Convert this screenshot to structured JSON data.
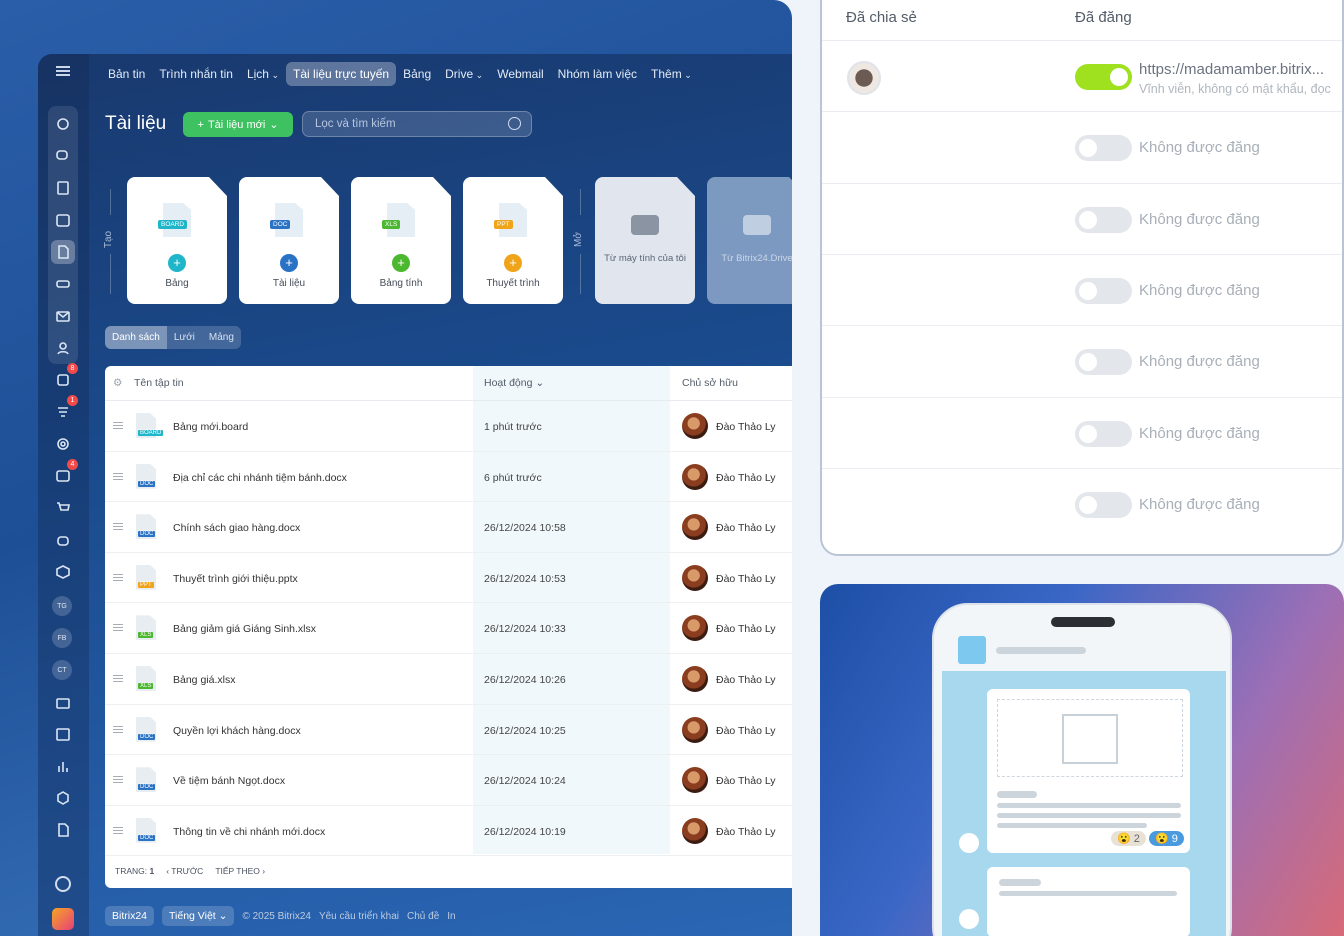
{
  "topnav": [
    "Bản tin",
    "Trình nhắn tin",
    "Lịch",
    "Tài liệu trực tuyến",
    "Bảng",
    "Drive",
    "Webmail",
    "Nhóm làm việc",
    "Thêm"
  ],
  "topnav_dropdowns": [
    "Lịch",
    "Drive",
    "Thêm"
  ],
  "active_tab": "Tài liệu trực tuyến",
  "page_title": "Tài liệu",
  "new_doc_button": "Tài liệu mới",
  "search_placeholder": "Lọc và tìm kiếm",
  "create_label": "Tạo",
  "open_label": "Mở",
  "create_cards": [
    {
      "tag": "BOARD",
      "label": "Bảng",
      "color": "#1fb6c9"
    },
    {
      "tag": "DOC",
      "label": "Tài liệu",
      "color": "#2a72c4"
    },
    {
      "tag": "XLS",
      "label": "Bảng tính",
      "color": "#4cb82f"
    },
    {
      "tag": "PPT",
      "label": "Thuyết trình",
      "color": "#f0a419"
    }
  ],
  "open_cards": [
    "Từ máy tính của tôi",
    "Từ Bitrix24.Drive"
  ],
  "view_switch": [
    "Danh sách",
    "Lưới",
    "Mảng"
  ],
  "grid": {
    "headers": [
      "Tên tập tin",
      "Hoạt động",
      "Chủ sở hữu"
    ],
    "rows": [
      {
        "tag": "BOARD",
        "name": "Bảng mới.board",
        "activity": "1 phút trước",
        "owner": "Đào Thảo Ly"
      },
      {
        "tag": "DOC",
        "name": "Địa chỉ các chi nhánh tiệm bánh.docx",
        "activity": "6 phút trước",
        "owner": "Đào Thảo Ly"
      },
      {
        "tag": "DOC",
        "name": "Chính sách giao hàng.docx",
        "activity": "26/12/2024 10:58",
        "owner": "Đào Thảo Ly"
      },
      {
        "tag": "PPT",
        "name": "Thuyết trình giới thiệu.pptx",
        "activity": "26/12/2024 10:53",
        "owner": "Đào Thảo Ly"
      },
      {
        "tag": "XLS",
        "name": "Bảng giảm giá Giáng Sinh.xlsx",
        "activity": "26/12/2024 10:33",
        "owner": "Đào Thảo Ly"
      },
      {
        "tag": "XLS",
        "name": "Bảng giá.xlsx",
        "activity": "26/12/2024 10:26",
        "owner": "Đào Thảo Ly"
      },
      {
        "tag": "DOC",
        "name": "Quyền lợi khách hàng.docx",
        "activity": "26/12/2024 10:25",
        "owner": "Đào Thảo Ly"
      },
      {
        "tag": "DOC",
        "name": "Về tiệm bánh Ngọt.docx",
        "activity": "26/12/2024 10:24",
        "owner": "Đào Thảo Ly"
      },
      {
        "tag": "DOC",
        "name": "Thông tin về chi nhánh mới.docx",
        "activity": "26/12/2024 10:19",
        "owner": "Đào Thảo Ly"
      }
    ]
  },
  "tag_colors": {
    "BOARD": "#1fb6c9",
    "DOC": "#2a72c4",
    "XLS": "#4cb82f",
    "PPT": "#f0a419"
  },
  "pager": {
    "label": "TRANG:",
    "page": "1",
    "prev": "TRƯỚC",
    "next": "TIẾP THEO"
  },
  "footer": {
    "brand": "Bitrix24",
    "lang": "Tiếng Việt",
    "copyright": "© 2025 Bitrix24",
    "links": [
      "Yêu cầu triển khai",
      "Chủ đề",
      "In"
    ]
  },
  "sidebar_badges": {
    "tasks": "8",
    "crm": "1",
    "feed": "4"
  },
  "sidebar_circles": [
    "TG",
    "FB",
    "CT"
  ],
  "share_panel": {
    "col_shared": "Đã chia sẻ",
    "col_published": "Đã đăng",
    "published_url": "https://madamamber.bitrix...",
    "published_note": "Vĩnh viễn, không có mật khẩu, đọc",
    "not_published": "Không được đăng",
    "rows": 7
  },
  "phone_reactions": [
    {
      "emoji": "😮",
      "count": "2"
    },
    {
      "emoji": "😮",
      "count": "9"
    }
  ]
}
